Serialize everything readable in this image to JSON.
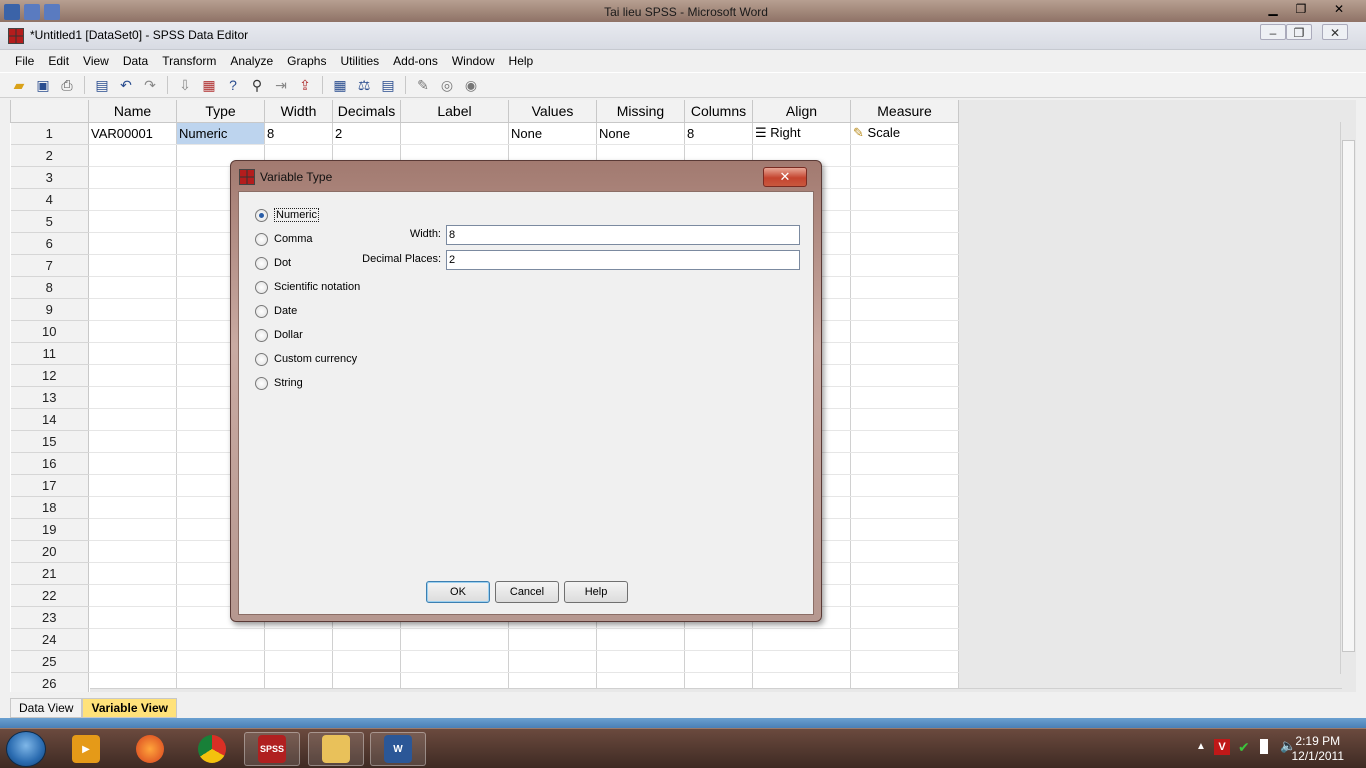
{
  "word_window": {
    "title": "Tai lieu SPSS - Microsoft Word"
  },
  "spss_window": {
    "title": "*Untitled1 [DataSet0] - SPSS Data Editor",
    "menu": [
      "File",
      "Edit",
      "View",
      "Data",
      "Transform",
      "Analyze",
      "Graphs",
      "Utilities",
      "Add-ons",
      "Window",
      "Help"
    ]
  },
  "grid": {
    "columns": [
      "Name",
      "Type",
      "Width",
      "Decimals",
      "Label",
      "Values",
      "Missing",
      "Columns",
      "Align",
      "Measure"
    ],
    "row1": {
      "name": "VAR00001",
      "type": "Numeric",
      "width": "8",
      "decimals": "2",
      "label": "",
      "values": "None",
      "missing": "None",
      "columns": "8",
      "align": "Right",
      "measure": "Scale"
    },
    "row_numbers": [
      "1",
      "2",
      "3",
      "4",
      "5",
      "6",
      "7",
      "8",
      "9",
      "10",
      "11",
      "12",
      "13",
      "14",
      "15",
      "16",
      "17",
      "18",
      "19",
      "20",
      "21",
      "22",
      "23",
      "24",
      "25",
      "26"
    ]
  },
  "tabs": {
    "data_view": "Data View",
    "variable_view": "Variable View"
  },
  "dialog": {
    "title": "Variable Type",
    "close": "✕",
    "options": [
      "Numeric",
      "Comma",
      "Dot",
      "Scientific notation",
      "Date",
      "Dollar",
      "Custom currency",
      "String"
    ],
    "selected": "Numeric",
    "width_label": "Width:",
    "width_value": "8",
    "decimals_label": "Decimal Places:",
    "decimals_value": "2",
    "ok": "OK",
    "cancel": "Cancel",
    "help": "Help"
  },
  "taskbar": {
    "spss_label": "SPSS",
    "time": "2:19 PM",
    "date": "12/1/2011"
  }
}
